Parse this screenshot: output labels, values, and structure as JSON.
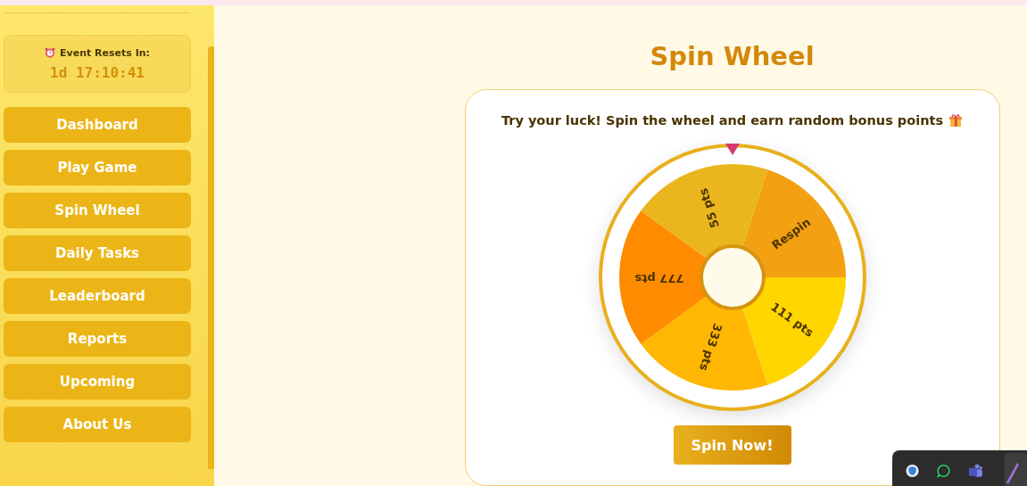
{
  "sidebar": {
    "timer": {
      "label": "Event Resets In:",
      "value": "1d 17:10:41"
    },
    "items": [
      {
        "label": "Dashboard",
        "selected": false
      },
      {
        "label": "Play Game",
        "selected": false
      },
      {
        "label": "Spin Wheel",
        "selected": false
      },
      {
        "label": "Daily Tasks",
        "selected": false
      },
      {
        "label": "Leaderboard",
        "selected": false
      },
      {
        "label": "Reports",
        "selected": false
      },
      {
        "label": "Upcoming",
        "selected": false
      },
      {
        "label": "About Us",
        "selected": false
      }
    ]
  },
  "main": {
    "title": "Spin Wheel",
    "intro": "Try your luck! Spin the wheel and earn random bonus points",
    "wheel": {
      "segments": [
        {
          "label": "55 pts",
          "color": "#eab61e"
        },
        {
          "label": "Respin",
          "color": "#f3a012"
        },
        {
          "label": "111 pts",
          "color": "#ffd600"
        },
        {
          "label": "333 pts",
          "color": "#ffb703"
        },
        {
          "label": "777 pts",
          "color": "#ff8c00"
        }
      ]
    },
    "button": "Spin Now!"
  }
}
